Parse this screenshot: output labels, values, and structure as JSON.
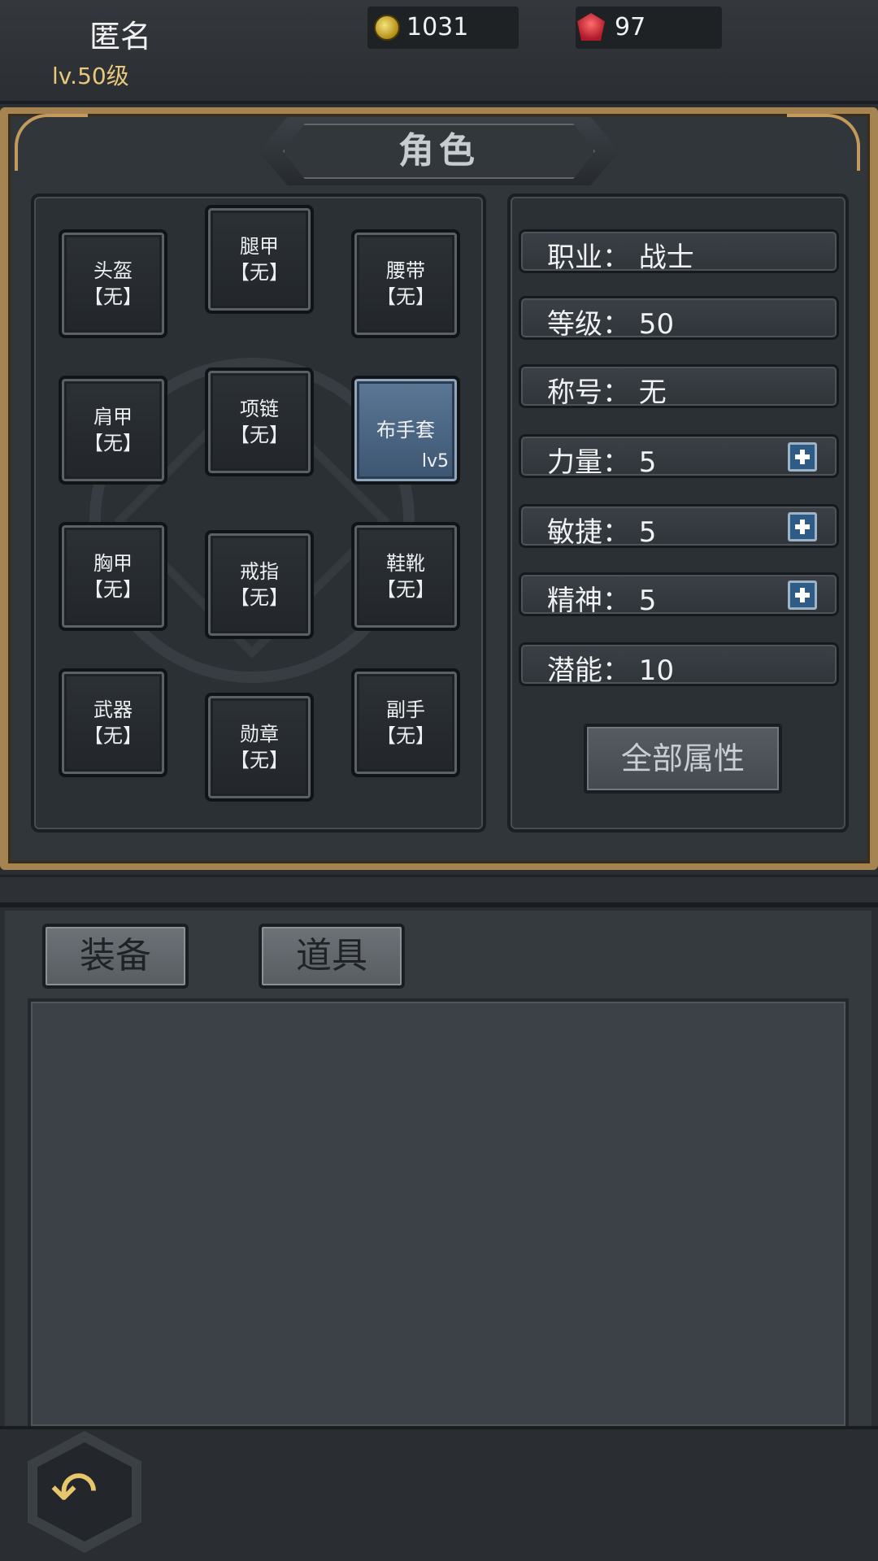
{
  "player": {
    "name": "匿名",
    "level": "lv.50级"
  },
  "currencies": {
    "gold": {
      "icon": "gold-coin-icon",
      "value": "1031"
    },
    "gem": {
      "icon": "red-gem-icon",
      "value": "97"
    }
  },
  "panel": {
    "title": "角色"
  },
  "equipment": {
    "helmet": {
      "name": "头盔",
      "state": "【无】"
    },
    "legs": {
      "name": "腿甲",
      "state": "【无】"
    },
    "belt": {
      "name": "腰带",
      "state": "【无】"
    },
    "shoulder": {
      "name": "肩甲",
      "state": "【无】"
    },
    "necklace": {
      "name": "项链",
      "state": "【无】"
    },
    "gloves": {
      "name": "布手套",
      "level": "lv5"
    },
    "chest": {
      "name": "胸甲",
      "state": "【无】"
    },
    "ring": {
      "name": "戒指",
      "state": "【无】"
    },
    "boots": {
      "name": "鞋靴",
      "state": "【无】"
    },
    "weapon": {
      "name": "武器",
      "state": "【无】"
    },
    "medal": {
      "name": "勋章",
      "state": "【无】"
    },
    "offhand": {
      "name": "副手",
      "state": "【无】"
    }
  },
  "stats": {
    "class": "职业：  战士",
    "level": "等级：  50",
    "title": "称号：  无",
    "strength": "力量：  5",
    "agility": "敏捷：  5",
    "spirit": "精神：  5",
    "potential": "潜能：  10"
  },
  "buttons": {
    "all_attributes": "全部属性"
  },
  "inventory_tabs": {
    "equipment": "装备",
    "items": "道具"
  },
  "colors": {
    "accent_gold": "#e8c87a",
    "frame_gold": "#a58452",
    "equipped_blue": "#4f6a88",
    "plus_blue": "#2f5c86"
  }
}
